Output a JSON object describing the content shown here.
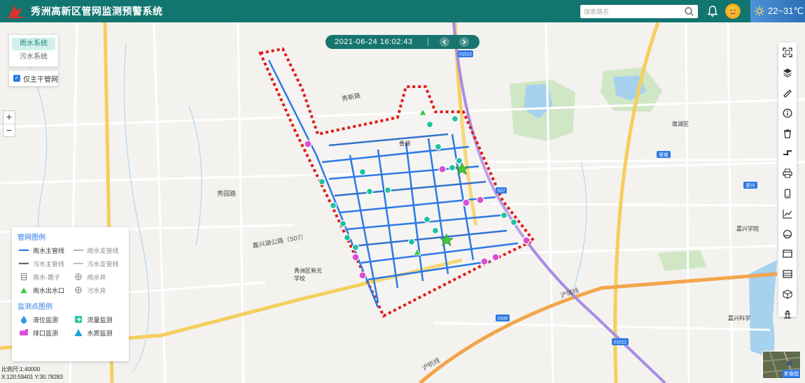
{
  "header": {
    "title": "秀洲高新区管网监测预警系统",
    "search_placeholder": "搜索路名",
    "weather": "22~31℃"
  },
  "layers": {
    "items": [
      "雨水系统",
      "污水系统"
    ],
    "active": 0
  },
  "trunk_toggle": {
    "label": "仅主干管网",
    "checked": true
  },
  "zoom": {
    "in": "+",
    "out": "−"
  },
  "datetime": "2021-06-24 16:02:43",
  "legend": {
    "pipe_title": "管网图例",
    "pipe_items": [
      {
        "label": "雨水主管线",
        "dim": false,
        "color": "#2d79e6"
      },
      {
        "label": "雨水支管线",
        "dim": true,
        "color": "#999999"
      },
      {
        "label": "污水主管线",
        "dim": true,
        "color": "#777777"
      },
      {
        "label": "污水支管线",
        "dim": true,
        "color": "#aaaaaa"
      },
      {
        "label": "雨水-篦子",
        "dim": true
      },
      {
        "label": "雨水井",
        "dim": true
      },
      {
        "label": "雨水出水口",
        "dim": false,
        "color": "#3ec940"
      },
      {
        "label": "污水井",
        "dim": true
      }
    ],
    "monitor_title": "监测点图例",
    "monitor_items": [
      {
        "label": "液位监测",
        "color": "#2d9be0"
      },
      {
        "label": "流量监测",
        "color": "#20c2a0"
      },
      {
        "label": "排口监测",
        "color": "#d94fd3"
      },
      {
        "label": "水质监测",
        "color": "#1aa3d9"
      }
    ]
  },
  "scale": {
    "line1": "比例尺:1:40000",
    "line2": "X:120.59401  Y:30.78283"
  },
  "map": {
    "road_labels": [
      "秀新路",
      "秀园路",
      "嘉兴湖公路（S07）",
      "沪杭线",
      "沪瑞线",
      "1522",
      "0335",
      "新城"
    ],
    "place_labels": [
      "嘉兴学院",
      "南湖区",
      "嘉兴科学",
      "香湖",
      "秀洲区新光学校"
    ]
  },
  "thumb_label": "影像图",
  "colors": {
    "header": "#12756f",
    "accent": "#2d79e6",
    "boundary": "#e01b1b"
  }
}
